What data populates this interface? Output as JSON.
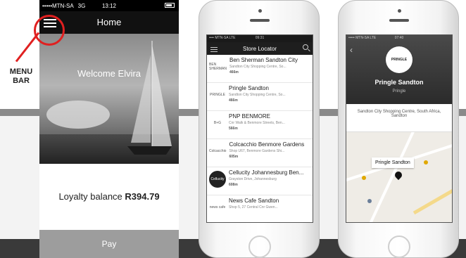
{
  "annotation": {
    "label_line1": "MENU",
    "label_line2": "BAR",
    "accent_color": "#e02020"
  },
  "home_screen": {
    "status": {
      "carrier": "•••••MTN-SA",
      "network": "3G",
      "time": "13:12"
    },
    "header": {
      "title": "Home",
      "menu_icon": "hamburger-icon"
    },
    "welcome": "Welcome Elvira",
    "loyalty_label": "Loyalty balance",
    "loyalty_value": "R394.79",
    "pay_label": "Pay"
  },
  "store_locator": {
    "status": {
      "carrier": "•••• MTN-SA LTE",
      "time": "09:31"
    },
    "header": {
      "title": "Store Locator"
    },
    "stores": [
      {
        "logo": "BEN SHERMAN",
        "name": "Ben Sherman Sandton City",
        "address": "Sandton City Shopping Centre, So...",
        "distance": "466m"
      },
      {
        "logo": "PRINGLE",
        "name": "Pringle Sandton",
        "address": "Sandton City Shopping Centre, So...",
        "distance": "466m"
      },
      {
        "logo": "B+G",
        "name": "PNP BENMORE",
        "address": "Cnr Walk & Benmore Streets, Ben...",
        "distance": "566m"
      },
      {
        "logo": "Colcacchio",
        "name": "Colcacchio Benmore Gardens",
        "address": "Shop U67, Benmore Gardens Shi...",
        "distance": "605m"
      },
      {
        "logo": "Cellucity",
        "name": "Cellucity Johannesburg Ben...",
        "address": "Grayston Drive, Johannesburg",
        "distance": "608m"
      },
      {
        "logo": "news cafe",
        "name": "News Cafe Sandton",
        "address": "Shop 5, 27 Central Cnr Gwen...",
        "distance": ""
      }
    ]
  },
  "store_detail": {
    "status": {
      "carrier": "••••• MTN-SA LTE",
      "time": "07:40"
    },
    "logo": "PRINGLE",
    "name": "Pringle Sandton",
    "brand": "Pringle",
    "address": "Sandton City Shopping Centre, South Africa, Sandton",
    "map_callout": "Pringle Sandton"
  }
}
